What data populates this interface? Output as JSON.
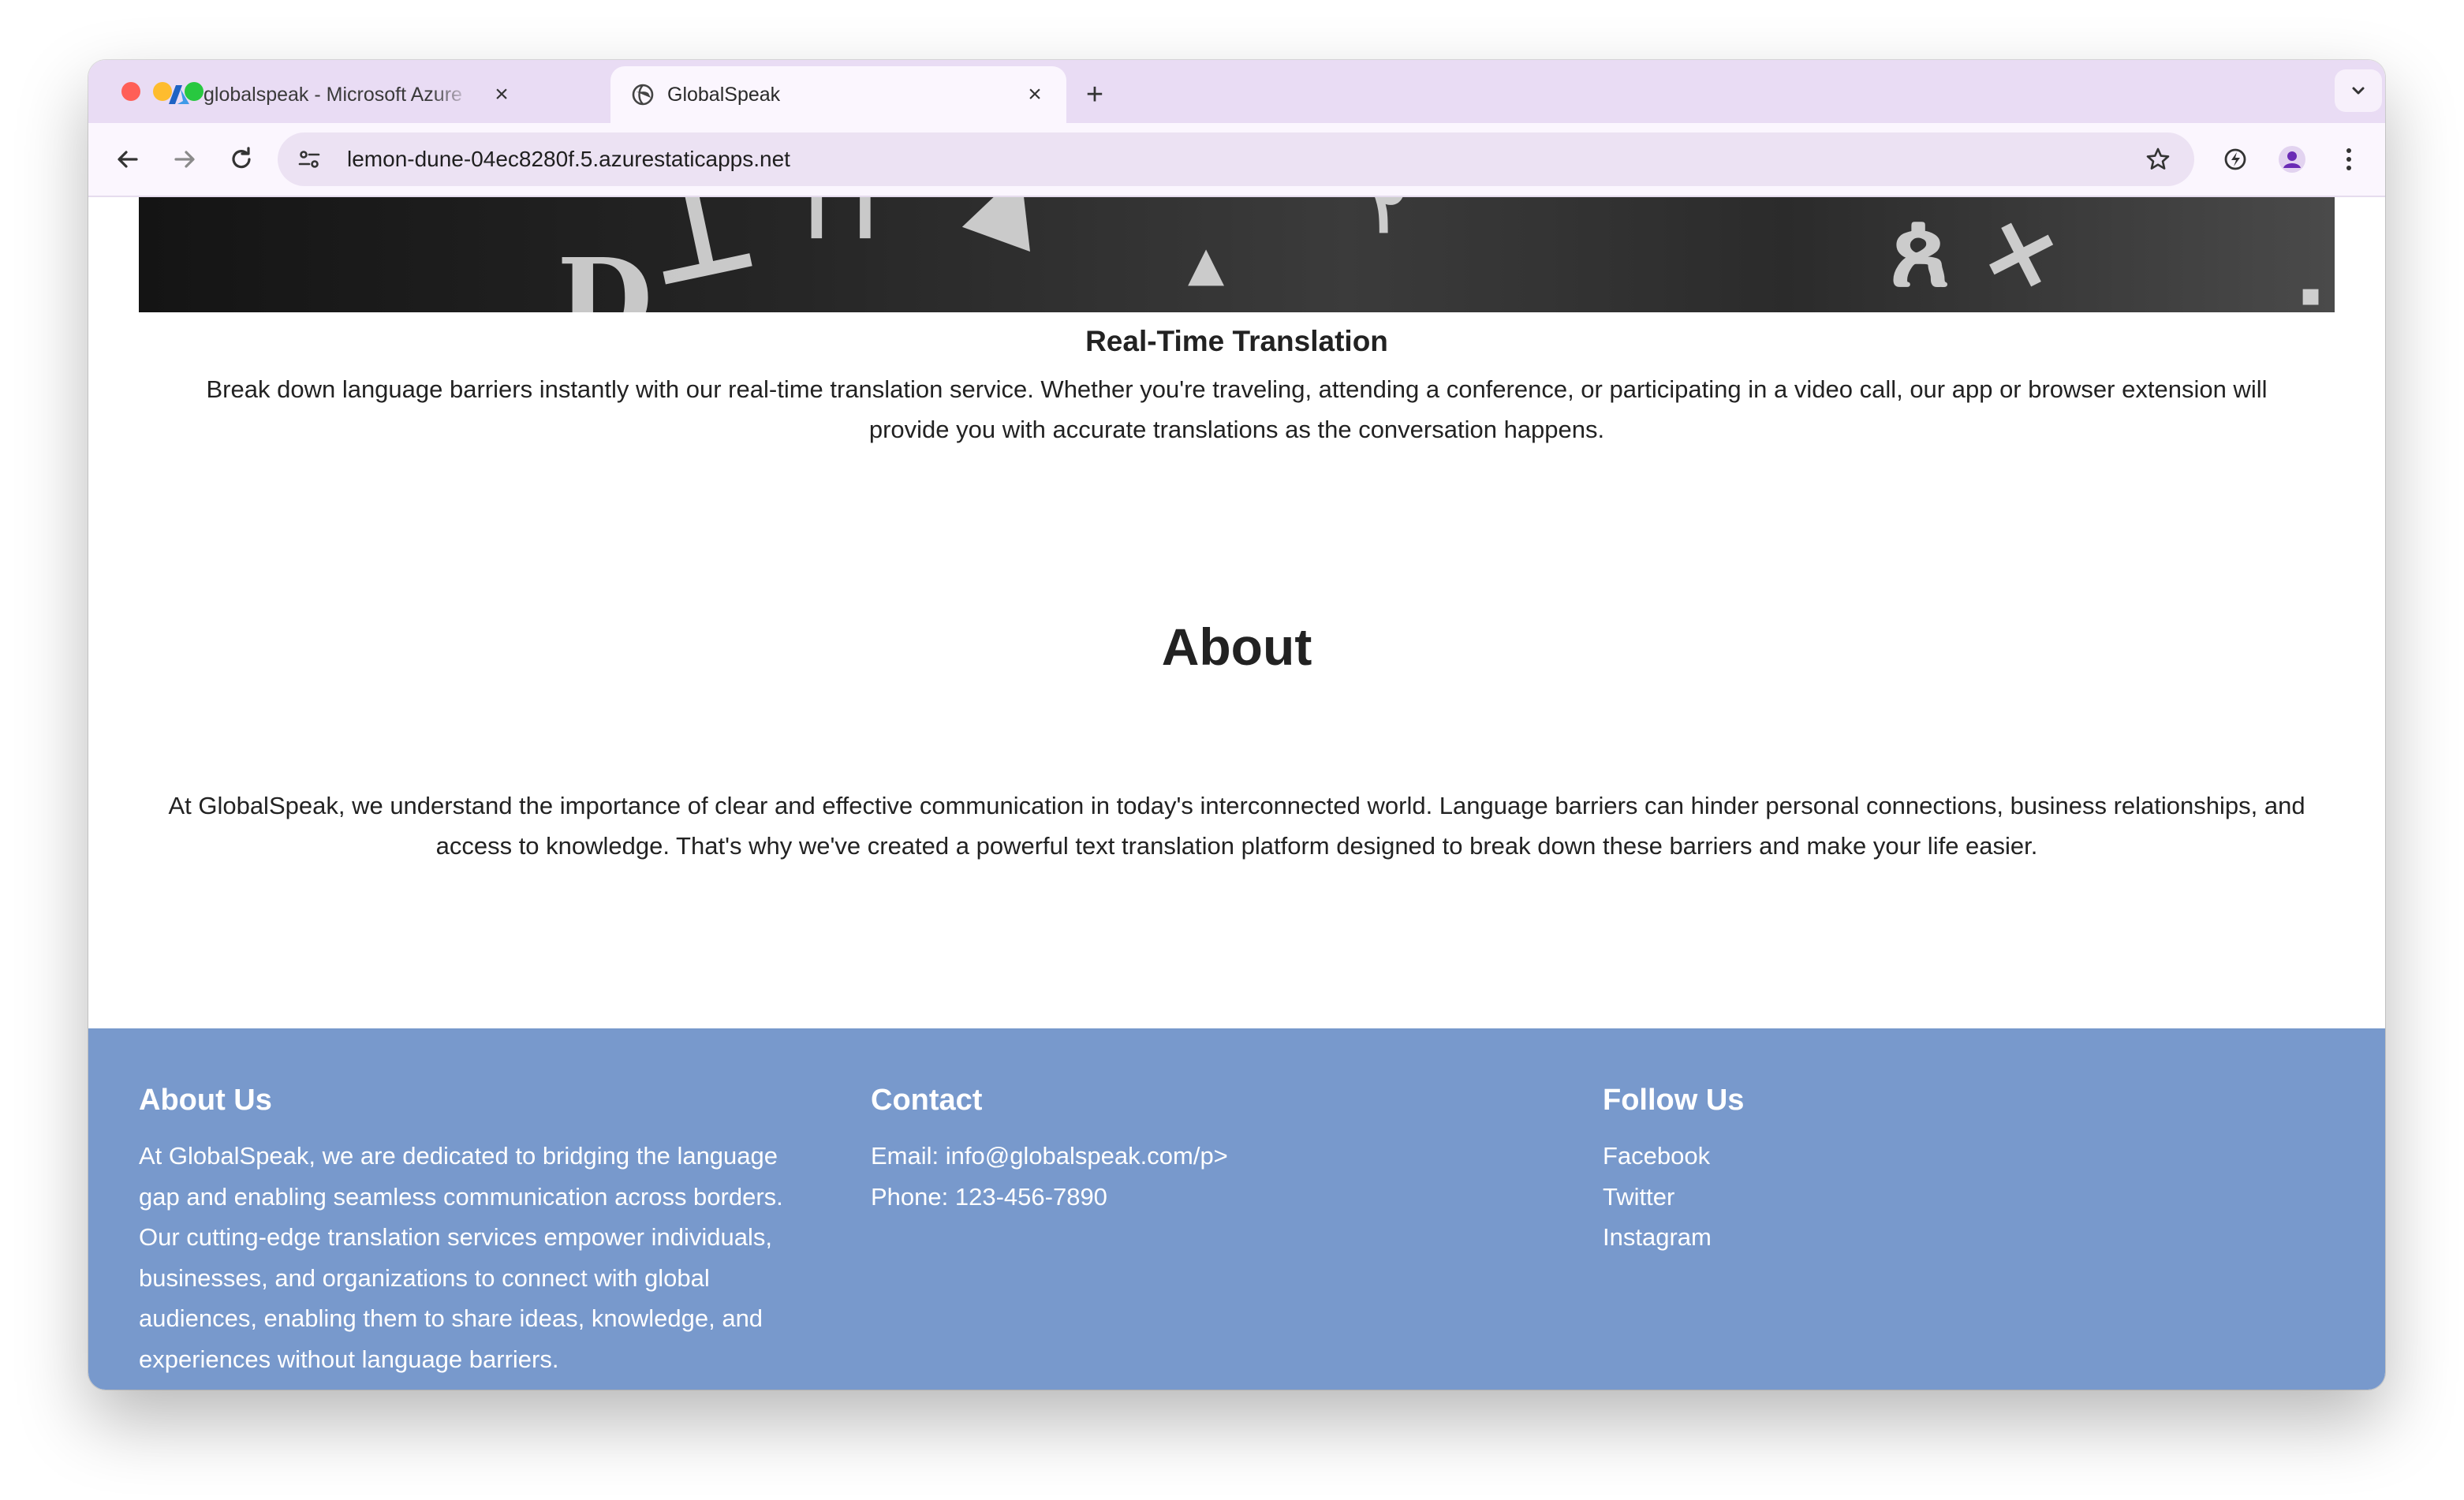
{
  "browser": {
    "tabs": [
      {
        "title": "globalspeak - Microsoft Azure",
        "active": false,
        "icon": "azure-icon"
      },
      {
        "title": "GlobalSpeak",
        "active": true,
        "icon": "globe-icon"
      }
    ],
    "url": "lemon-dune-04ec8280f.5.azurestaticapps.net"
  },
  "page": {
    "feature": {
      "title": "Real-Time Translation",
      "text": "Break down language barriers instantly with our real-time translation service. Whether you're traveling, attending a conference, or participating in a video call, our app or browser extension will provide you with accurate translations as the conversation happens."
    },
    "about": {
      "heading": "About",
      "text": "At GlobalSpeak, we understand the importance of clear and effective communication in today's interconnected world. Language barriers can hinder personal connections, business relationships, and access to knowledge. That's why we've created a powerful text translation platform designed to break down these barriers and make your life easier."
    },
    "footer": {
      "about": {
        "heading": "About Us",
        "text": "At GlobalSpeak, we are dedicated to bridging the language gap and enabling seamless communication across borders. Our cutting-edge translation services empower individuals, businesses, and organizations to connect with global audiences, enabling them to share ideas, knowledge, and experiences without language barriers."
      },
      "contact": {
        "heading": "Contact",
        "email": "Email: info@globalspeak.com/p>",
        "phone": "Phone: 123-456-7890"
      },
      "follow": {
        "heading": "Follow Us",
        "links": [
          "Facebook",
          "Twitter",
          "Instagram"
        ]
      }
    }
  },
  "colors": {
    "tabstrip": "#e9dcf4",
    "toolbar": "#fbf6fe",
    "footer": "#7899cc",
    "text": "#222222"
  }
}
